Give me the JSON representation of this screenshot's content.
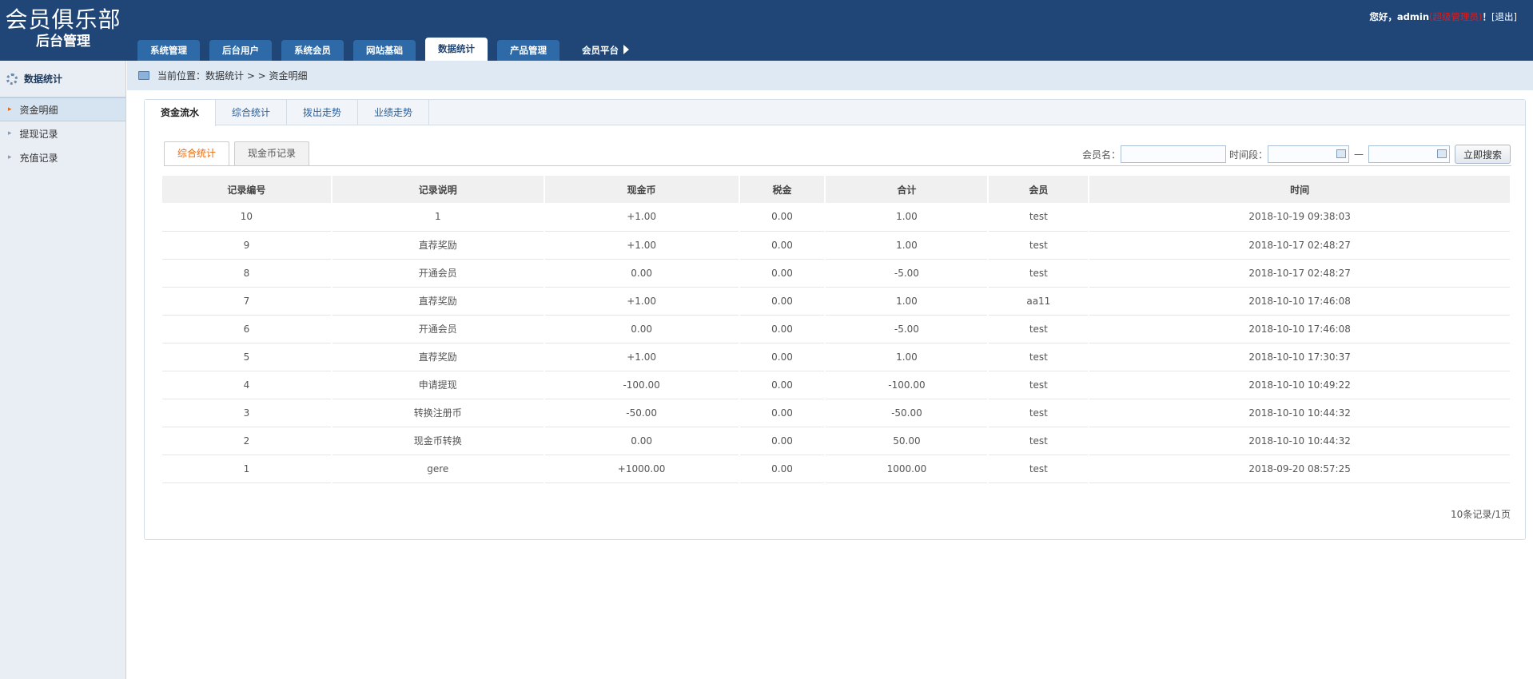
{
  "header": {
    "title": "会员俱乐部",
    "subtitle": "后台管理",
    "nav": [
      {
        "label": "系统管理",
        "active": false
      },
      {
        "label": "后台用户",
        "active": false
      },
      {
        "label": "系统会员",
        "active": false
      },
      {
        "label": "网站基础",
        "active": false
      },
      {
        "label": "数据统计",
        "active": true
      },
      {
        "label": "产品管理",
        "active": false
      },
      {
        "label": "会员平台",
        "active": false
      }
    ],
    "greeting": "您好，admin",
    "role": "(超级管理员)",
    "exclaim": "！",
    "logout": "[退出]"
  },
  "sidebar": {
    "title": "数据统计",
    "items": [
      {
        "label": "资金明细",
        "active": true
      },
      {
        "label": "提现记录",
        "active": false
      },
      {
        "label": "充值记录",
        "active": false
      }
    ]
  },
  "breadcrumb": "当前位置：数据统计 > > 资金明细",
  "tabs": [
    "资金流水",
    "综合统计",
    "拨出走势",
    "业绩走势"
  ],
  "subtabs": [
    "综合统计",
    "现金币记录"
  ],
  "search": {
    "member_label": "会员名：",
    "member_value": "",
    "period_label": "时间段：",
    "date_from": "",
    "date_to": "",
    "dash": "—",
    "button": "立即搜索"
  },
  "table": {
    "headers": [
      "记录编号",
      "记录说明",
      "现金币",
      "税金",
      "合计",
      "会员",
      "时间"
    ],
    "rows": [
      [
        "10",
        "1",
        "+1.00",
        "0.00",
        "1.00",
        "test",
        "2018-10-19 09:38:03"
      ],
      [
        "9",
        "直荐奖励",
        "+1.00",
        "0.00",
        "1.00",
        "test",
        "2018-10-17 02:48:27"
      ],
      [
        "8",
        "开通会员",
        "0.00",
        "0.00",
        "-5.00",
        "test",
        "2018-10-17 02:48:27"
      ],
      [
        "7",
        "直荐奖励",
        "+1.00",
        "0.00",
        "1.00",
        "aa11",
        "2018-10-10 17:46:08"
      ],
      [
        "6",
        "开通会员",
        "0.00",
        "0.00",
        "-5.00",
        "test",
        "2018-10-10 17:46:08"
      ],
      [
        "5",
        "直荐奖励",
        "+1.00",
        "0.00",
        "1.00",
        "test",
        "2018-10-10 17:30:37"
      ],
      [
        "4",
        "申请提现",
        "-100.00",
        "0.00",
        "-100.00",
        "test",
        "2018-10-10 10:49:22"
      ],
      [
        "3",
        "转换注册币",
        "-50.00",
        "0.00",
        "-50.00",
        "test",
        "2018-10-10 10:44:32"
      ],
      [
        "2",
        "现金币转换",
        "0.00",
        "0.00",
        "50.00",
        "test",
        "2018-10-10 10:44:32"
      ],
      [
        "1",
        "gere",
        "+1000.00",
        "0.00",
        "1000.00",
        "test",
        "2018-09-20 08:57:25"
      ]
    ]
  },
  "pager": "10条记录/1页",
  "colors": {
    "header_bg": "#1f4677",
    "nav_tab": "#2f6aa8",
    "accent_orange": "#e86a10",
    "value_red": "#d9361b"
  }
}
